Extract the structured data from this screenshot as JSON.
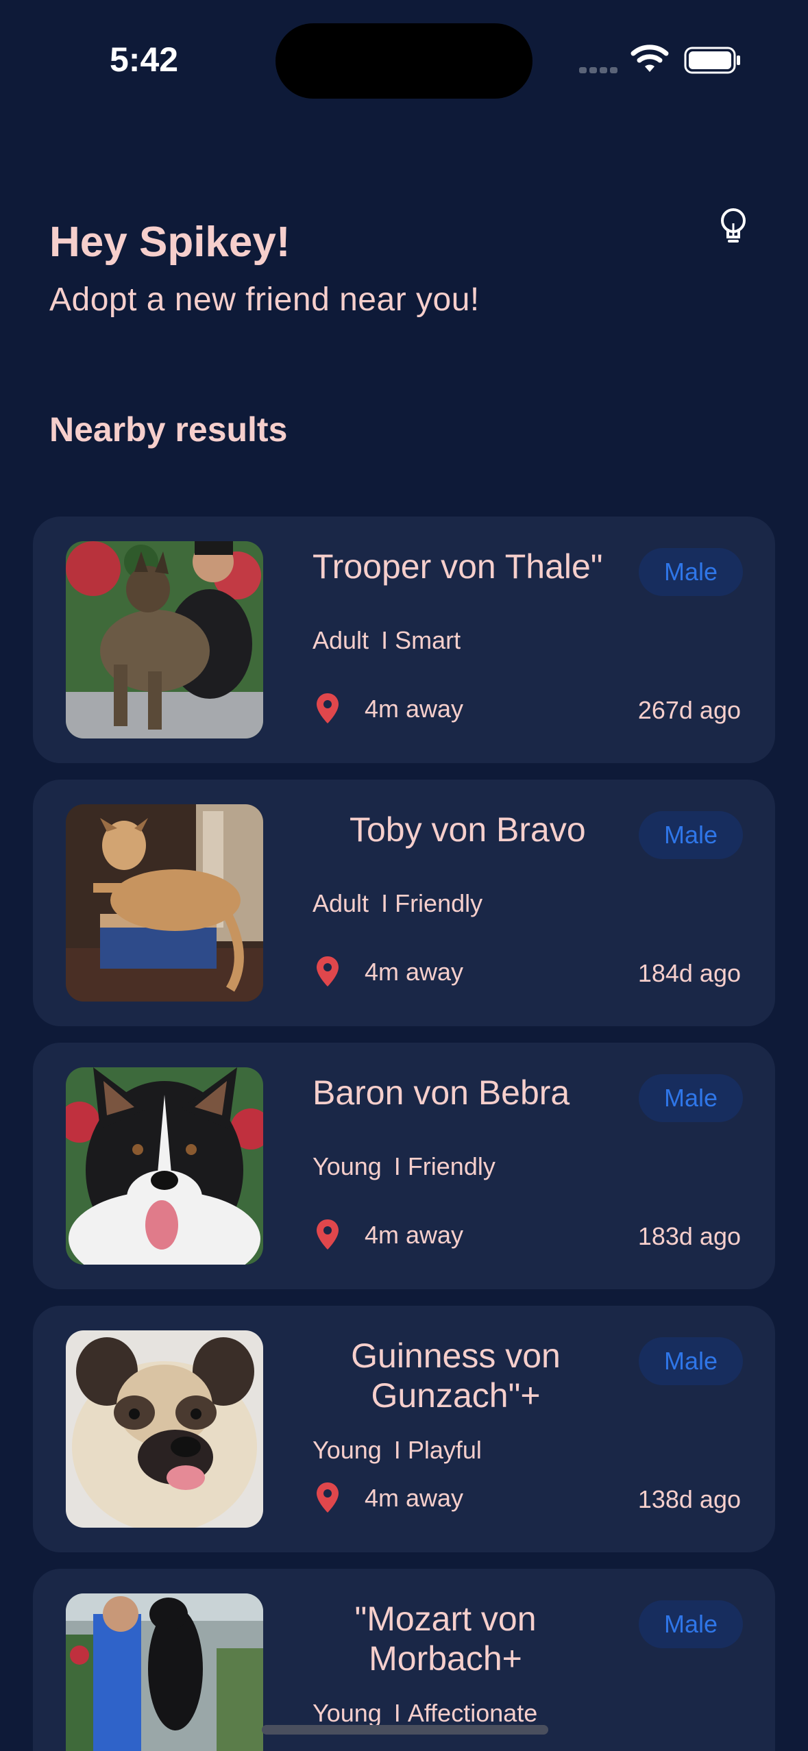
{
  "status_bar": {
    "time": "5:42"
  },
  "header": {
    "greeting": "Hey Spikey!",
    "subtitle": "Adopt a new friend near you!"
  },
  "section_title": "Nearby results",
  "pets": [
    {
      "name": "Trooper von Thale\"",
      "gender": "Male",
      "age_group": "Adult",
      "trait": "Smart",
      "distance": "4m away",
      "posted": "267d ago"
    },
    {
      "name": "Toby von Bravo",
      "gender": "Male",
      "age_group": "Adult",
      "trait": "Friendly",
      "distance": "4m away",
      "posted": "184d ago"
    },
    {
      "name": "Baron von Bebra",
      "gender": "Male",
      "age_group": "Young",
      "trait": "Friendly",
      "distance": "4m away",
      "posted": "183d ago"
    },
    {
      "name": "Guinness von Gunzach\"+",
      "gender": "Male",
      "age_group": "Young",
      "trait": "Playful",
      "distance": "4m away",
      "posted": "138d ago"
    },
    {
      "name": "\"Mozart von Morbach+",
      "gender": "Male",
      "age_group": "Young",
      "trait": "Affectionate",
      "distance": "",
      "posted": ""
    }
  ],
  "trait_separator": "I",
  "colors": {
    "background": "#0e1a38",
    "card": "#1a2747",
    "text": "#f6cfcc",
    "badge_bg": "#172d5e",
    "badge_text": "#2f76e8",
    "pin": "#e0474c"
  },
  "icons": [
    "wifi-icon",
    "battery-icon",
    "lightbulb-icon",
    "location-pin-icon"
  ]
}
